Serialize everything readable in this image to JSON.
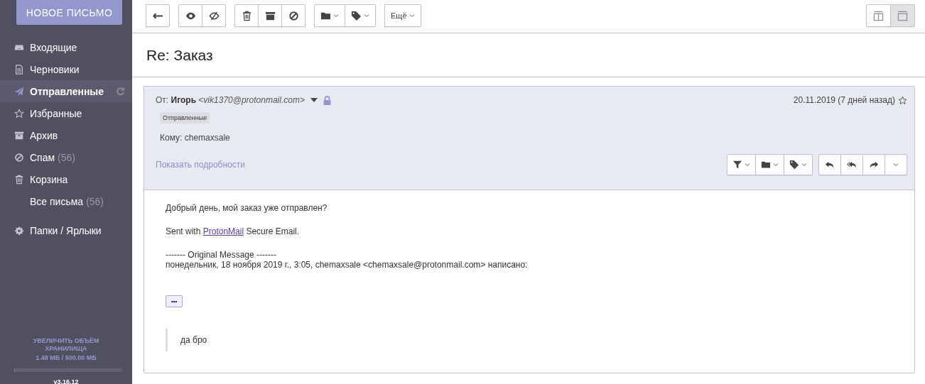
{
  "compose_button": "НОВОЕ ПИСЬМО",
  "sidebar": {
    "items": [
      {
        "label": "Входящие",
        "selected": false
      },
      {
        "label": "Черновики",
        "selected": false
      },
      {
        "label": "Отправленные",
        "selected": true
      },
      {
        "label": "Избранные",
        "selected": false
      },
      {
        "label": "Архив",
        "selected": false
      },
      {
        "label": "Спам",
        "count": "(56)",
        "selected": false
      },
      {
        "label": "Корзина",
        "selected": false
      },
      {
        "label": "Все письма",
        "count": "(56)",
        "selected": false
      }
    ],
    "folders_link": "Папки / Ярлыки"
  },
  "storage": {
    "upgrade": "УВЕЛИЧИТЬ ОБЪЁМ ХРАНИЛИЩА",
    "usage": "1.48 МБ / 500.00 МБ",
    "level": 0.003
  },
  "version": "v3.16.12",
  "toolbar": {
    "more": "Ещё"
  },
  "layout_toggles": [
    {
      "selected": false
    },
    {
      "selected": true
    }
  ],
  "subject": "Re: Заказ",
  "message": {
    "from_label": "От:",
    "sender_name": "Игорь",
    "sender_email": "<vik1370@protonmail.com>",
    "tag": "Отправленные",
    "to": "Кому: chemaxsale",
    "details_link": "Показать подробности",
    "date": "20.11.2019 (7 дней назад)",
    "starred": false,
    "body": {
      "greeting": "Добрый день, мой заказ уже отправлен?",
      "signature": {
        "before": "Sent with",
        "link": "ProtonMail",
        "after": "Secure Email."
      },
      "original_header": "------- Original Message -------",
      "original_meta": "понедельник, 18 ноября 2019 г., 3:05, chemaxsale <chemaxsale@protonmail.com> написано:",
      "expand": "•••",
      "quote": "да бро"
    }
  }
}
